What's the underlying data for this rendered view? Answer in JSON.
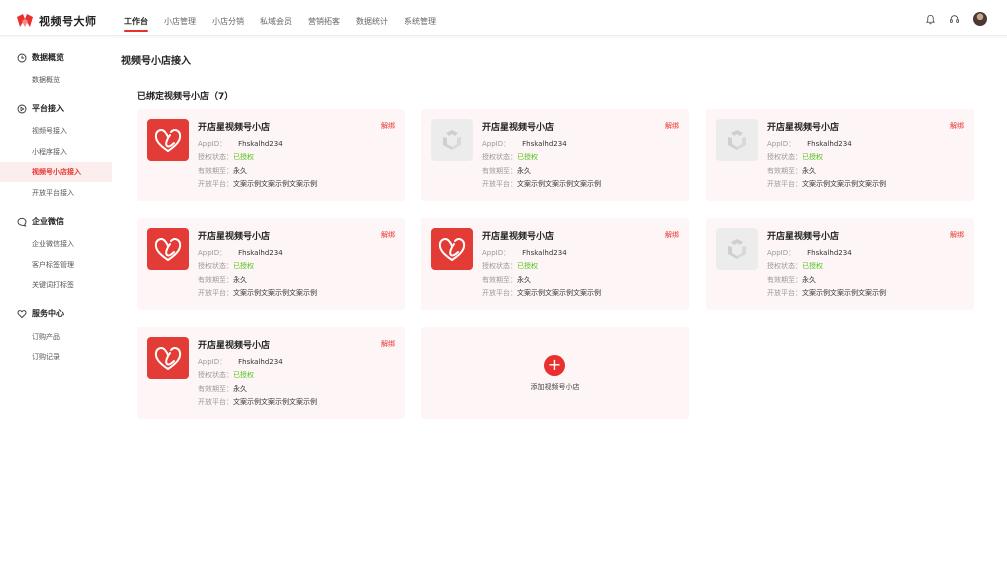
{
  "brand": {
    "name": "视频号大师",
    "color": "#e8312f"
  },
  "nav": {
    "items": [
      "工作台",
      "小店管理",
      "小店分销",
      "私域会员",
      "营销拓客",
      "数据统计",
      "系统管理"
    ],
    "active": 0
  },
  "top_icons": [
    "bell-icon",
    "headset-icon",
    "avatar"
  ],
  "sidebar": {
    "groups": [
      {
        "title": "数据概览",
        "icon": "clock-icon",
        "items": [
          "数据概览"
        ]
      },
      {
        "title": "平台接入",
        "icon": "play-circle-icon",
        "items": [
          "视频号接入",
          "小程序接入",
          "视频号小店接入",
          "开放平台接入"
        ]
      },
      {
        "title": "企业微信",
        "icon": "chat-icon",
        "items": [
          "企业微信接入",
          "客户标签管理",
          "关键词打标签"
        ]
      },
      {
        "title": "服务中心",
        "icon": "heart-icon",
        "items": [
          "订购产品",
          "订购记录"
        ]
      }
    ],
    "active_item": "视频号小店接入"
  },
  "main": {
    "page_title": "视频号小店接入",
    "section_title": "已绑定视频号小店（7）",
    "labels": {
      "appid": "AppID：",
      "auth": "授权状态：",
      "valid": "有效期至：",
      "platform": "开放平台："
    },
    "unbind_label": "解绑",
    "cards": [
      {
        "name": "开店星视频号小店",
        "appid": "Fhskalhd234",
        "auth": "已授权",
        "valid": "永久",
        "platform": "文案示例文案示例文案示例",
        "logo": "red"
      },
      {
        "name": "开店星视频号小店",
        "appid": "Fhskalhd234",
        "auth": "已授权",
        "valid": "永久",
        "platform": "文案示例文案示例文案示例",
        "logo": "gray"
      },
      {
        "name": "开店星视频号小店",
        "appid": "Fhskalhd234",
        "auth": "已授权",
        "valid": "永久",
        "platform": "文案示例文案示例文案示例",
        "logo": "gray"
      },
      {
        "name": "开店星视频号小店",
        "appid": "Fhskalhd234",
        "auth": "已授权",
        "valid": "永久",
        "platform": "文案示例文案示例文案示例",
        "logo": "red"
      },
      {
        "name": "开店星视频号小店",
        "appid": "Fhskalhd234",
        "auth": "已授权",
        "valid": "永久",
        "platform": "文案示例文案示例文案示例",
        "logo": "red"
      },
      {
        "name": "开店星视频号小店",
        "appid": "Fhskalhd234",
        "auth": "已授权",
        "valid": "永久",
        "platform": "文案示例文案示例文案示例",
        "logo": "gray"
      },
      {
        "name": "开店星视频号小店",
        "appid": "Fhskalhd234",
        "auth": "已授权",
        "valid": "永久",
        "platform": "文案示例文案示例文案示例",
        "logo": "red"
      }
    ],
    "add_label": "添加视频号小店"
  }
}
